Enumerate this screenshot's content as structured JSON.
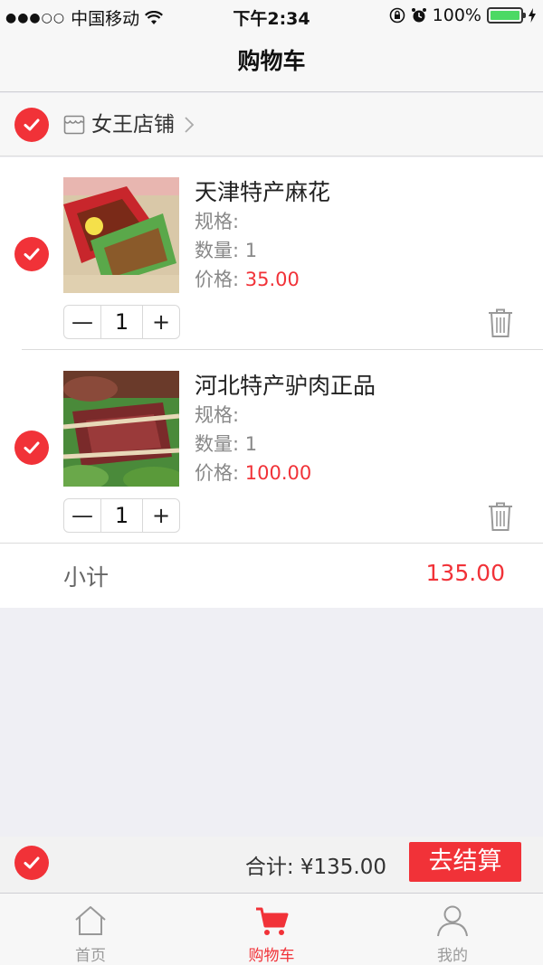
{
  "status_bar": {
    "carrier": "中国移动",
    "time": "下午2:34",
    "battery": "100%",
    "signal_dots": "●●●○○"
  },
  "nav": {
    "title": "购物车"
  },
  "shop": {
    "name": "女王店铺"
  },
  "items": [
    {
      "title": "天津特产麻花",
      "spec_label": "规格:",
      "qty_label": "数量:",
      "qty_value": "1",
      "price_label": "价格:",
      "price_value": "35.00",
      "stepper_minus": "—",
      "stepper_value": "1",
      "stepper_plus": "+"
    },
    {
      "title": "河北特产驴肉正品",
      "spec_label": "规格:",
      "qty_label": "数量:",
      "qty_value": "1",
      "price_label": "价格:",
      "price_value": "100.00",
      "stepper_minus": "—",
      "stepper_value": "1",
      "stepper_plus": "+"
    }
  ],
  "subtotal": {
    "label": "小计",
    "value": "135.00"
  },
  "checkout": {
    "total": "合计: ¥135.00",
    "button": "去结算"
  },
  "tabs": [
    {
      "label": "首页",
      "icon": "home-icon"
    },
    {
      "label": "购物车",
      "icon": "cart-icon"
    },
    {
      "label": "我的",
      "icon": "user-icon"
    }
  ],
  "colors": {
    "accent": "#f13238",
    "battery": "#4cd964"
  }
}
